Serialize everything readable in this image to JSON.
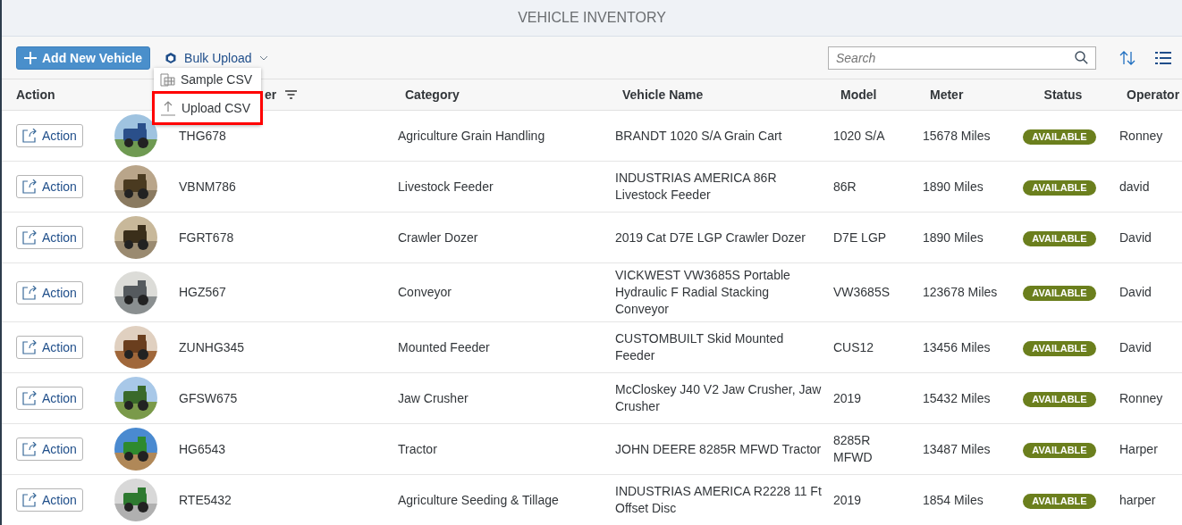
{
  "title": "VEHICLE INVENTORY",
  "toolbar": {
    "add_button": "Add New Vehicle",
    "bulk_upload": "Bulk Upload",
    "search": {
      "placeholder": "Search"
    }
  },
  "menu": [
    {
      "label": "Sample CSV",
      "highlighted": false,
      "kind": "sheet"
    },
    {
      "label": "Upload CSV",
      "highlighted": true,
      "kind": "upload"
    }
  ],
  "table": {
    "columns": [
      "Action",
      "er",
      "Category",
      "Vehicle Name",
      "Model",
      "Meter",
      "Status",
      "Operator"
    ],
    "rows": [
      {
        "action": "Action",
        "number": "THG678",
        "category": "Agriculture Grain Handling",
        "name": "BRANDT 1020 S/A Grain Cart",
        "model": "1020 S/A",
        "meter": "15678 Miles",
        "status": "AVAILABLE",
        "operator": "Ronney"
      },
      {
        "action": "Action",
        "number": "VBNM786",
        "category": "Livestock Feeder",
        "name": "INDUSTRIAS AMERICA 86R Livestock Feeder",
        "model": "86R",
        "meter": "1890 Miles",
        "status": "AVAILABLE",
        "operator": "david"
      },
      {
        "action": "Action",
        "number": "FGRT678",
        "category": "Crawler Dozer",
        "name": "2019 Cat D7E LGP Crawler Dozer",
        "model": "D7E LGP",
        "meter": "1890 Miles",
        "status": "AVAILABLE",
        "operator": "David"
      },
      {
        "action": "Action",
        "number": "HGZ567",
        "category": "Conveyor",
        "name": "VICKWEST VW3685S Portable Hydraulic F Radial Stacking Conveyor",
        "model": "VW3685S",
        "meter": "123678 Miles",
        "status": "AVAILABLE",
        "operator": "David"
      },
      {
        "action": "Action",
        "number": "ZUNHG345",
        "category": "Mounted Feeder",
        "name": "CUSTOMBUILT Skid Mounted Feeder",
        "model": "CUS12",
        "meter": "13456 Miles",
        "status": "AVAILABLE",
        "operator": "David"
      },
      {
        "action": "Action",
        "number": "GFSW675",
        "category": "Jaw Crusher",
        "name": "McCloskey J40 V2 Jaw Crusher, Jaw Crusher",
        "model": "2019",
        "meter": "15432 Miles",
        "status": "AVAILABLE",
        "operator": "Ronney"
      },
      {
        "action": "Action",
        "number": "HG6543",
        "category": "Tractor",
        "name": "JOHN DEERE 8285R MFWD Tractor",
        "model": "8285R MFWD",
        "meter": "13487 Miles",
        "status": "AVAILABLE",
        "operator": "Harper"
      },
      {
        "action": "Action",
        "number": "RTE5432",
        "category": "Agriculture Seeding & Tillage",
        "name": "INDUSTRIAS AMERICA R2228 11 Ft Offset Disc",
        "model": "2019",
        "meter": "1854 Miles",
        "status": "AVAILABLE",
        "operator": "harper"
      }
    ]
  }
}
